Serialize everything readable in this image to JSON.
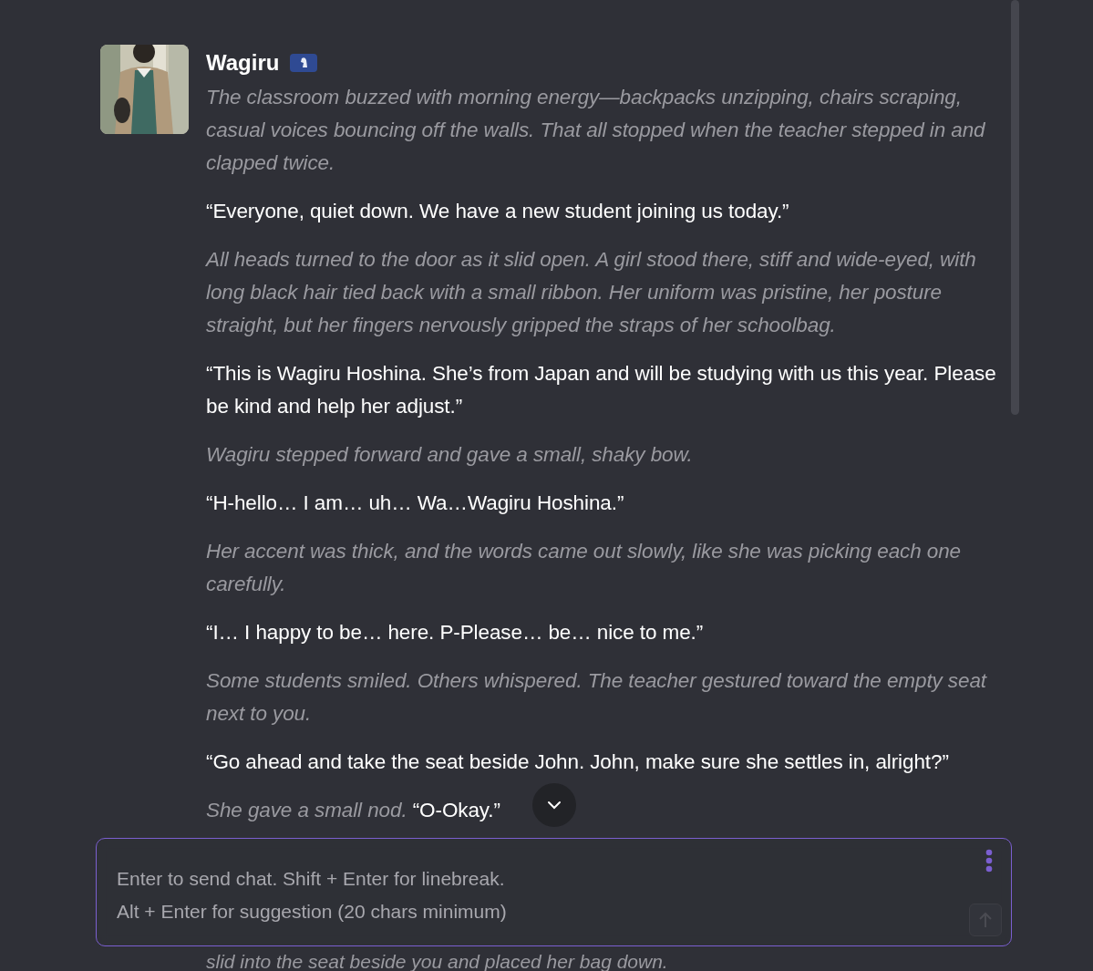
{
  "message": {
    "author": "Wagiru",
    "paragraphs": [
      {
        "segments": [
          {
            "kind": "narration",
            "text": "The classroom buzzed with morning energy—backpacks unzipping, chairs scraping, casual voices bouncing off the walls. That all stopped when the teacher stepped in and clapped twice."
          }
        ]
      },
      {
        "segments": [
          {
            "kind": "speech",
            "text": "“Everyone, quiet down. We have a new student joining us today.”"
          }
        ]
      },
      {
        "segments": [
          {
            "kind": "narration",
            "text": "All heads turned to the door as it slid open. A girl stood there, stiff and wide-eyed, with long black hair tied back with a small ribbon. Her uniform was pristine, her posture straight, but her fingers nervously gripped the straps of her schoolbag."
          }
        ]
      },
      {
        "segments": [
          {
            "kind": "speech",
            "text": "“This is Wagiru Hoshina. She’s from Japan and will be studying with us this year. Please be kind and help her adjust.”"
          }
        ]
      },
      {
        "segments": [
          {
            "kind": "narration",
            "text": "Wagiru stepped forward and gave a small, shaky bow."
          }
        ]
      },
      {
        "segments": [
          {
            "kind": "speech",
            "text": "“H-hello… I am… uh… Wa…Wagiru Hoshina.”"
          }
        ]
      },
      {
        "segments": [
          {
            "kind": "narration",
            "text": "Her accent was thick, and the words came out slowly, like she was picking each one carefully."
          }
        ]
      },
      {
        "segments": [
          {
            "kind": "speech",
            "text": "“I… I happy to be… here. P-Please… be… nice to me.”"
          }
        ]
      },
      {
        "segments": [
          {
            "kind": "narration",
            "text": "Some students smiled. Others whispered. The teacher gestured toward the empty seat next to you."
          }
        ]
      },
      {
        "segments": [
          {
            "kind": "speech",
            "text": "“Go ahead and take the seat beside John. John, make sure she settles in, alright?”"
          }
        ]
      },
      {
        "segments": [
          {
            "kind": "narration",
            "text": "She gave a small nod."
          },
          {
            "kind": "speech",
            "text": "“O-Okay.”"
          }
        ]
      }
    ],
    "trailing_line": "slid into the seat beside you and placed her bag down."
  },
  "composer": {
    "placeholder": "Enter to send chat. Shift + Enter for linebreak.\nAlt + Enter for suggestion (20 chars minimum)"
  }
}
